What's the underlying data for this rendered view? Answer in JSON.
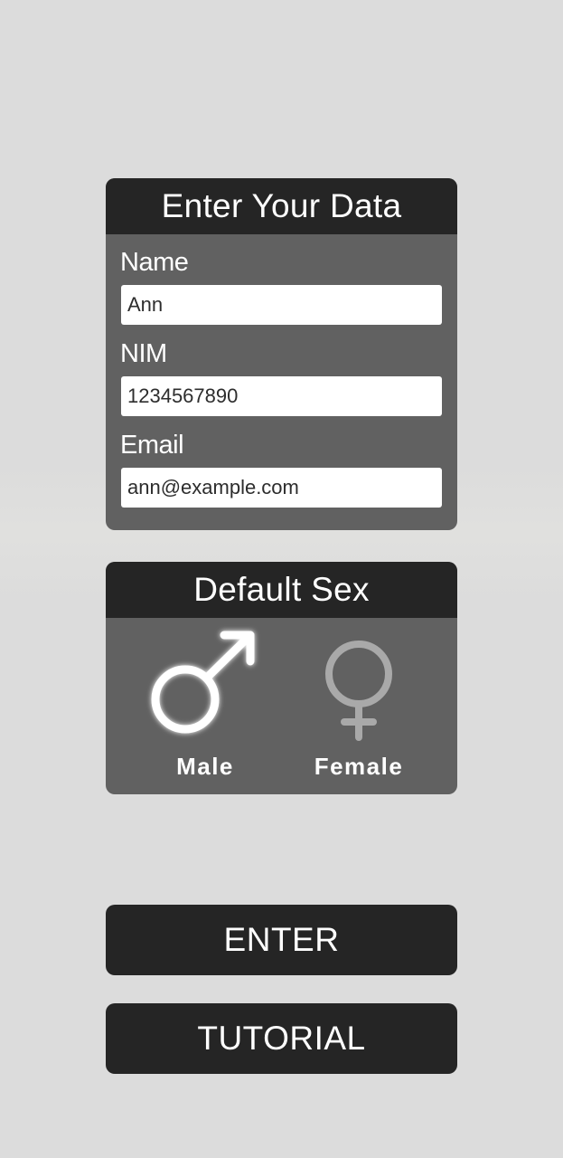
{
  "data_form": {
    "title": "Enter Your Data",
    "fields": [
      {
        "label": "Name",
        "value": "Ann"
      },
      {
        "label": "NIM",
        "value": "1234567890"
      },
      {
        "label": "Email",
        "value": "ann@example.com"
      }
    ]
  },
  "sex_selector": {
    "title": "Default Sex",
    "options": [
      {
        "label": "Male",
        "icon": "male-symbol-icon",
        "selected": true,
        "color": "#ffffff"
      },
      {
        "label": "Female",
        "icon": "female-symbol-icon",
        "selected": false,
        "color": "#a9a9a9"
      }
    ]
  },
  "actions": {
    "enter_label": "ENTER",
    "tutorial_label": "TUTORIAL"
  },
  "colors": {
    "background": "#dcdcdc",
    "panel": "#616161",
    "header": "#252525",
    "text": "#ffffff",
    "inactive": "#a9a9a9"
  }
}
